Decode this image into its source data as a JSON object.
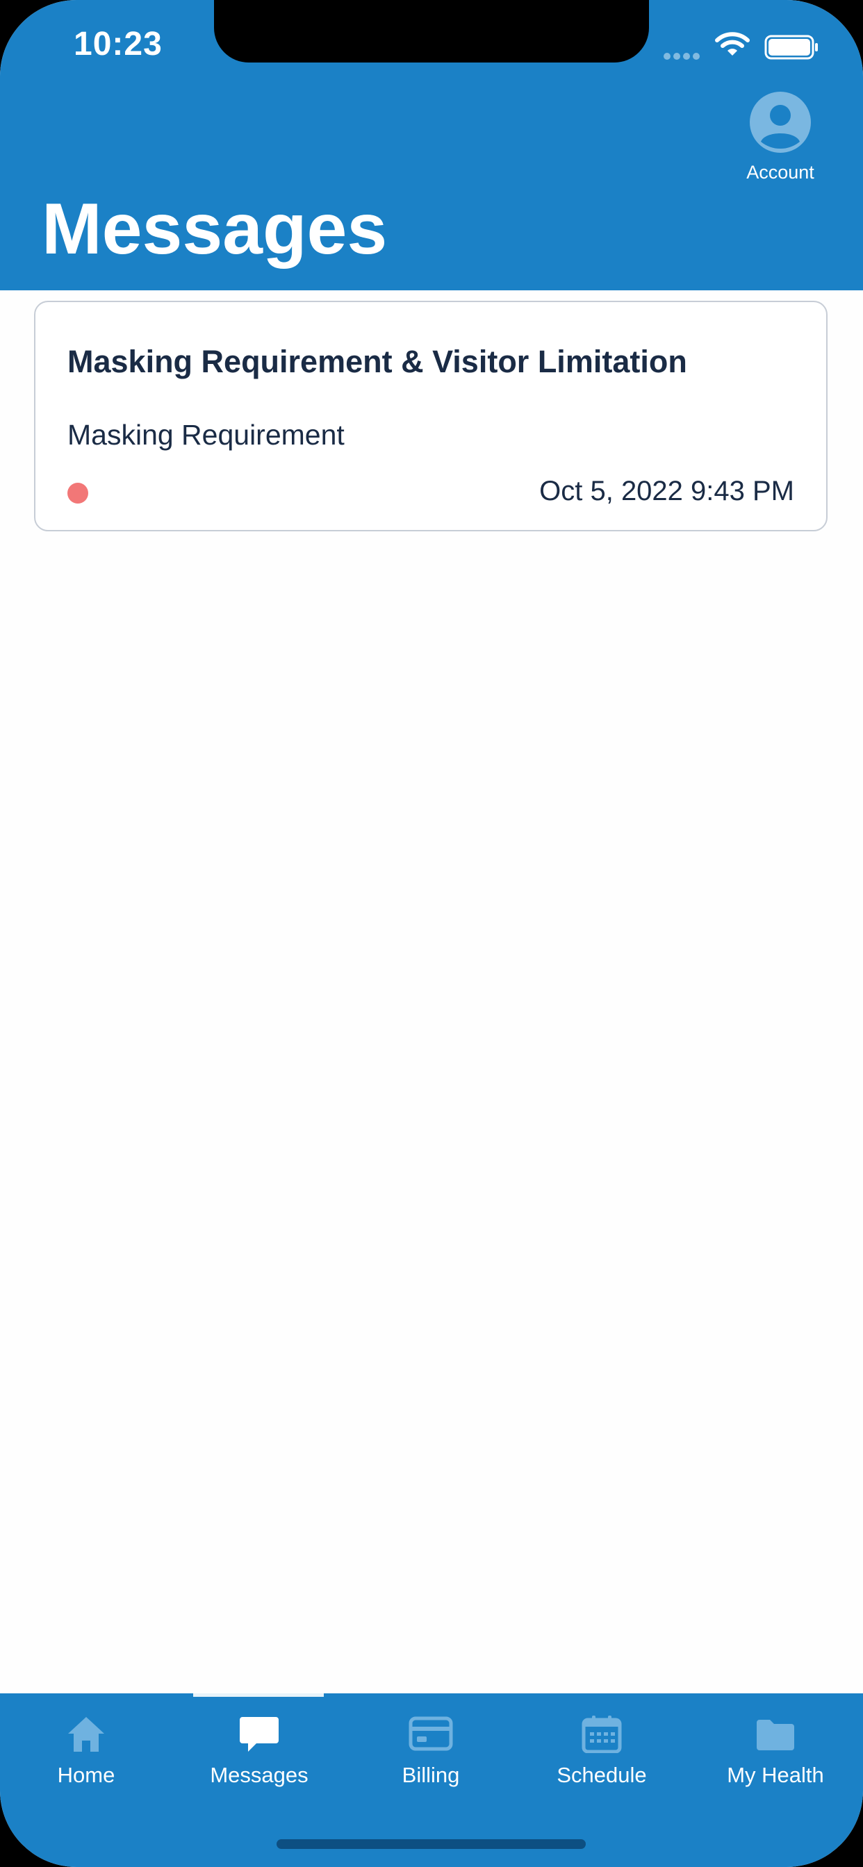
{
  "status_bar": {
    "time": "10:23"
  },
  "header": {
    "account_label": "Account",
    "title": "Messages",
    "background_color": "#1b81c6"
  },
  "messages": [
    {
      "title": "Masking Requirement & Visitor Limitation",
      "subtitle": "Masking Requirement",
      "date": "Oct 5, 2022 9:43 PM",
      "unread": true,
      "unread_color": "#f27777"
    }
  ],
  "tab_bar": {
    "active": "Messages",
    "tabs": [
      {
        "label": "Home",
        "icon": "home-icon"
      },
      {
        "label": "Messages",
        "icon": "chat-bubble-icon"
      },
      {
        "label": "Billing",
        "icon": "credit-card-icon"
      },
      {
        "label": "Schedule",
        "icon": "calendar-icon"
      },
      {
        "label": "My Health",
        "icon": "folder-icon"
      }
    ]
  }
}
